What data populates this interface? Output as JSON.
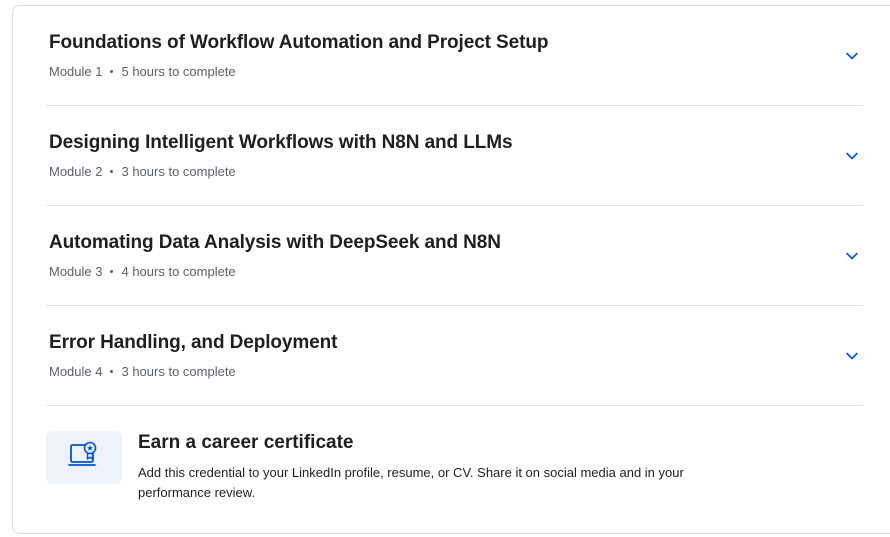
{
  "modules": [
    {
      "title": "Foundations of Workflow Automation and Project Setup",
      "module_label": "Module 1",
      "duration": "5 hours to complete"
    },
    {
      "title": "Designing Intelligent Workflows with N8N and LLMs",
      "module_label": "Module 2",
      "duration": "3 hours to complete"
    },
    {
      "title": "Automating Data Analysis with DeepSeek and N8N",
      "module_label": "Module 3",
      "duration": "4 hours to complete"
    },
    {
      "title": "Error Handling, and Deployment",
      "module_label": "Module 4",
      "duration": "3 hours to complete"
    }
  ],
  "certificate": {
    "title": "Earn a career certificate",
    "description": "Add this credential to your LinkedIn profile, resume, or CV. Share it on social media and in your performance review.",
    "icon": "certificate-icon"
  },
  "colors": {
    "accent": "#0056d2",
    "text": "#1f1f1f",
    "muted": "#5b6168",
    "divider": "#dcdee2",
    "icon_bg": "#eef3fb"
  }
}
